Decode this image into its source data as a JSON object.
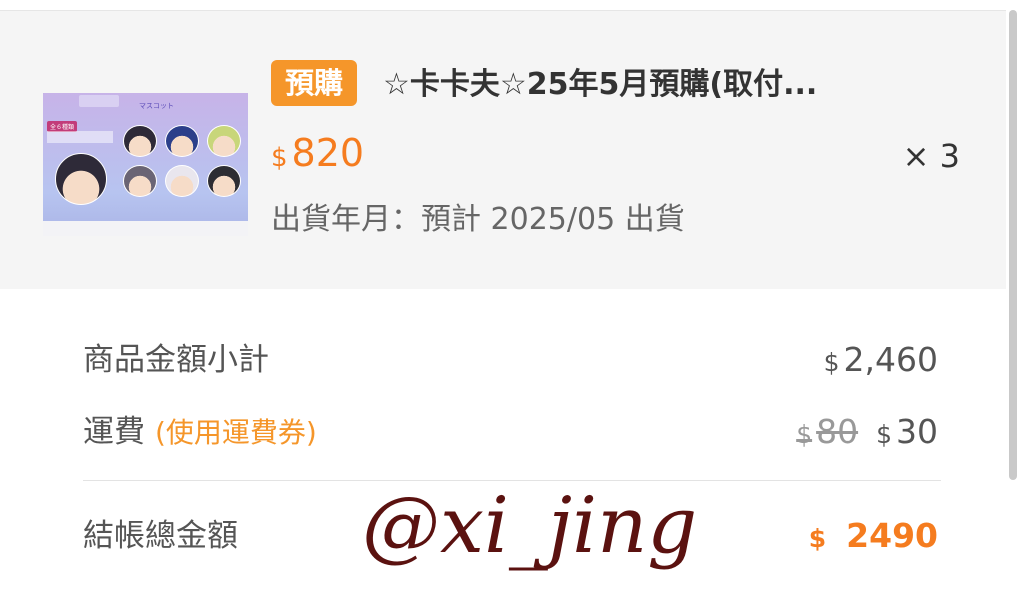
{
  "product": {
    "tag": "預購",
    "name": "☆卡卡夫☆25年5月預購(取付...",
    "currency_symbol": "$",
    "price": "820",
    "quantity": "× 3",
    "ship_date": "出貨年月：預計 2025/05 出貨",
    "thumbnail": {
      "badge": "全６種類",
      "title": "マスコット"
    }
  },
  "summary": {
    "subtotal_label": "商品金額小計",
    "subtotal_currency": "$",
    "subtotal_value": "2,460",
    "shipping_label": "運費",
    "shipping_coupon": "(使用運費券)",
    "shipping_old_currency": "$",
    "shipping_old_value": "80",
    "shipping_currency": "$",
    "shipping_value": "30",
    "total_label": "結帳總金額",
    "total_currency": "$",
    "total_value": "2490"
  },
  "watermark": "@xi_jing",
  "colors": {
    "accent_orange": "#f57c1f",
    "tag_orange": "#f5962a",
    "watermark": "#5b1210",
    "card_background": "#f5f5f5"
  }
}
